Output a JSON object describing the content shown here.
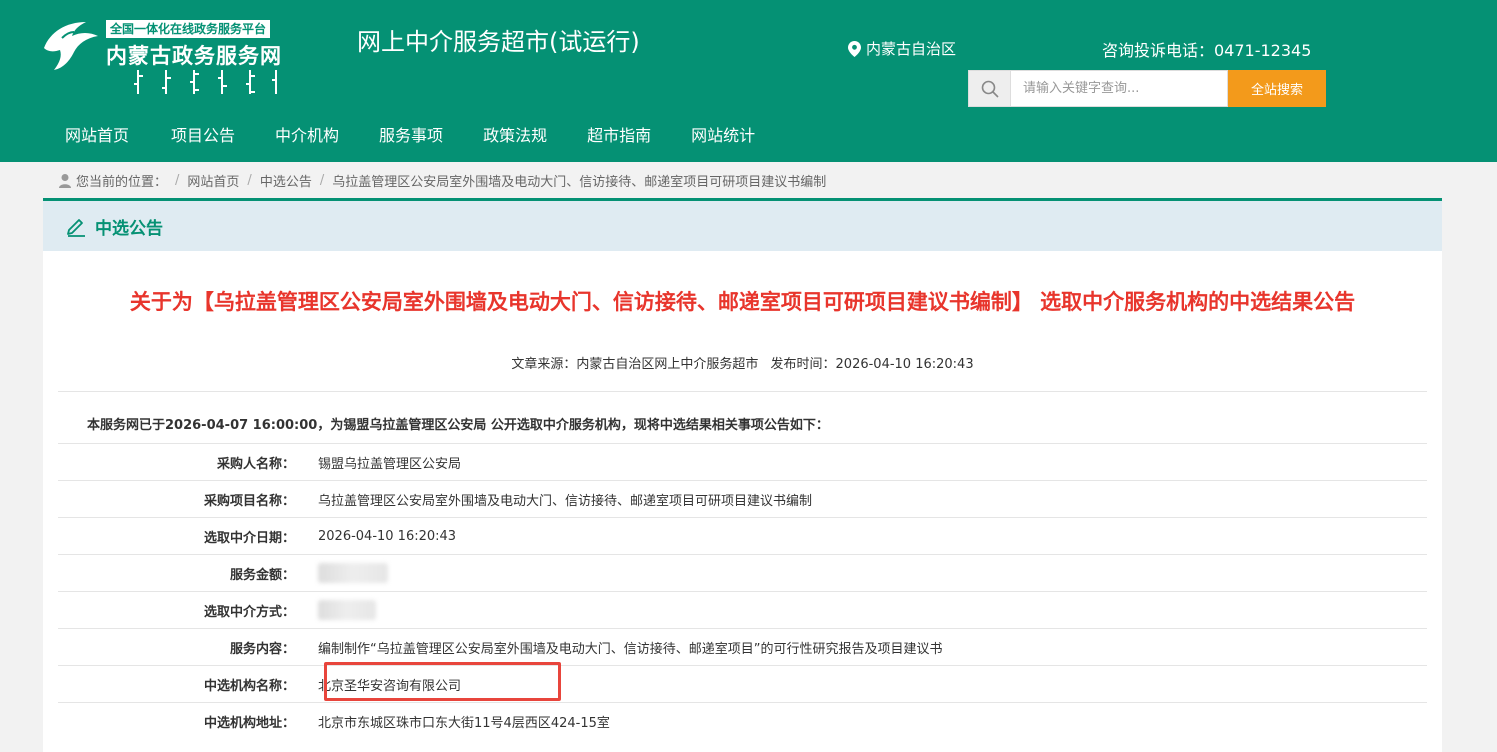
{
  "header": {
    "logo_badge": "全国一体化在线政务服务平台",
    "logo_name": "内蒙古政务服务网",
    "site_title": "网上中介服务超市(试运行)",
    "region": "内蒙古自治区",
    "hotline": "咨询投诉电话：0471-12345",
    "search": {
      "placeholder": "请输入关键字查询...",
      "button_label": "全站搜索"
    },
    "colors": {
      "brand": "#059174",
      "accent": "#f39a1b",
      "title_red": "#e8352c"
    }
  },
  "nav": {
    "items": [
      {
        "label": "网站首页"
      },
      {
        "label": "项目公告"
      },
      {
        "label": "中介机构"
      },
      {
        "label": "服务事项"
      },
      {
        "label": "政策法规"
      },
      {
        "label": "超市指南"
      },
      {
        "label": "网站统计"
      }
    ]
  },
  "breadcrumb": {
    "prefix": "您当前的位置：",
    "items": [
      "网站首页",
      "中选公告",
      "乌拉盖管理区公安局室外围墙及电动大门、信访接待、邮递室项目可研项目建议书编制"
    ]
  },
  "panel": {
    "heading": "中选公告",
    "article_title": "关于为【乌拉盖管理区公安局室外围墙及电动大门、信访接待、邮递室项目可研项目建议书编制】 选取中介服务机构的中选结果公告",
    "source": "文章来源：内蒙古自治区网上中介服务超市",
    "published": "发布时间：2026-04-10 16:20:43",
    "intro": "本服务网已于2026-04-07 16:00:00，为锡盟乌拉盖管理区公安局 公开选取中介服务机构，现将中选结果相关事项公告如下：",
    "rows": [
      {
        "label": "采购人名称：",
        "value": "锡盟乌拉盖管理区公安局"
      },
      {
        "label": "采购项目名称：",
        "value": "乌拉盖管理区公安局室外围墙及电动大门、信访接待、邮递室项目可研项目建议书编制"
      },
      {
        "label": "选取中介日期：",
        "value": "2026-04-10 16:20:43"
      },
      {
        "label": "服务金额：",
        "value": ""
      },
      {
        "label": "选取中介方式：",
        "value": ""
      },
      {
        "label": "服务内容：",
        "value": "编制制作“乌拉盖管理区公安局室外围墙及电动大门、信访接待、邮递室项目”的可行性研究报告及项目建议书"
      },
      {
        "label": "中选机构名称：",
        "value": "北京圣华安咨询有限公司"
      },
      {
        "label": "中选机构地址：",
        "value": "北京市东城区珠市口东大街11号4层西区424-15室"
      }
    ]
  }
}
